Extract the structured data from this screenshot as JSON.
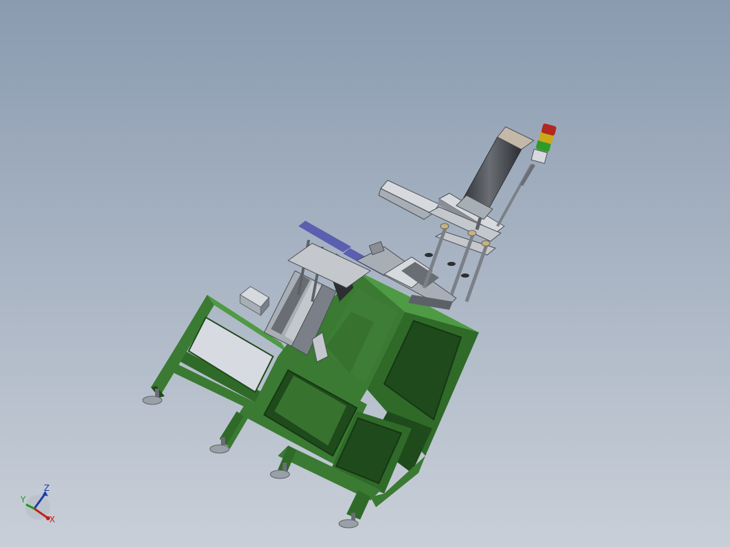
{
  "viewport": {
    "background_top": "#8a9bb0",
    "background_bottom": "#c9cfd8"
  },
  "colors": {
    "frame_green": "#3a7a32",
    "frame_green_dark": "#1f4a1c",
    "frame_green_light": "#4f9a44",
    "steel": "#a8aeb5",
    "steel_dark": "#5c6168",
    "steel_light": "#d6dade",
    "cylinder": "#4a4d52",
    "accent_blue": "#5b5fb0",
    "lamp_red": "#b0281f",
    "lamp_yellow": "#c9a91a",
    "lamp_green": "#2f9a2a",
    "brass": "#c8b37a"
  },
  "triad": {
    "x_label": "X",
    "y_label": "Y",
    "z_label": "Z",
    "x_color": "#c0201a",
    "y_color": "#1a9a1a",
    "z_color": "#1a3aa8"
  }
}
